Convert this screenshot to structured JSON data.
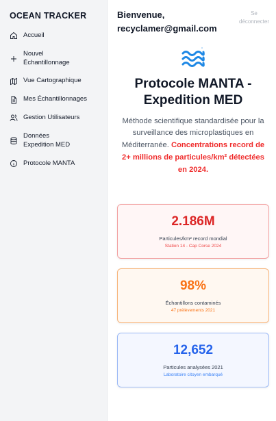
{
  "app": {
    "brand": "OCEAN TRACKER"
  },
  "sidebar": {
    "items": [
      {
        "label": "Accueil",
        "icon": "home-icon"
      },
      {
        "label": "Nouvel Échantillonnage",
        "icon": "plus-icon"
      },
      {
        "label": "Vue Cartographique",
        "icon": "map-icon"
      },
      {
        "label": "Mes Échantillonnages",
        "icon": "document-icon"
      },
      {
        "label": "Gestion Utilisateurs",
        "icon": "users-icon"
      },
      {
        "label": "Données Expedition MED",
        "icon": "database-icon"
      },
      {
        "label": "Protocole MANTA",
        "icon": "info-icon"
      }
    ]
  },
  "header": {
    "welcome_line1": "Bienvenue,",
    "welcome_line2": "recyclamer@gmail.com",
    "logout_line1": "Se",
    "logout_line2": "déconnecter"
  },
  "hero": {
    "icon": "waves-icon",
    "title": "Protocole MANTA - Expedition MED",
    "desc_plain": "Méthode scientifique standardisée pour la surveillance des microplastiques en Méditerranée.",
    "desc_highlight": "Concentrations record de 2+ millions de particules/km² détectées en 2024."
  },
  "stats": [
    {
      "value": "2.186M",
      "label": "Particules/km² record mondial",
      "note": "Station 14 - Cap Corse 2024",
      "color": "#dc2626"
    },
    {
      "value": "98%",
      "label": "Échantillons contaminés",
      "note": "47 prélèvements 2021",
      "color": "#f97316"
    },
    {
      "value": "12,652",
      "label": "Particules analysées 2021",
      "note": "Laboratoire citoyen embarqué",
      "color": "#2563eb"
    }
  ],
  "colors": {
    "accent_red": "#ef2b2b",
    "sidebar_bg": "#f3f4f6",
    "wave_blue": "#1e88e5"
  }
}
